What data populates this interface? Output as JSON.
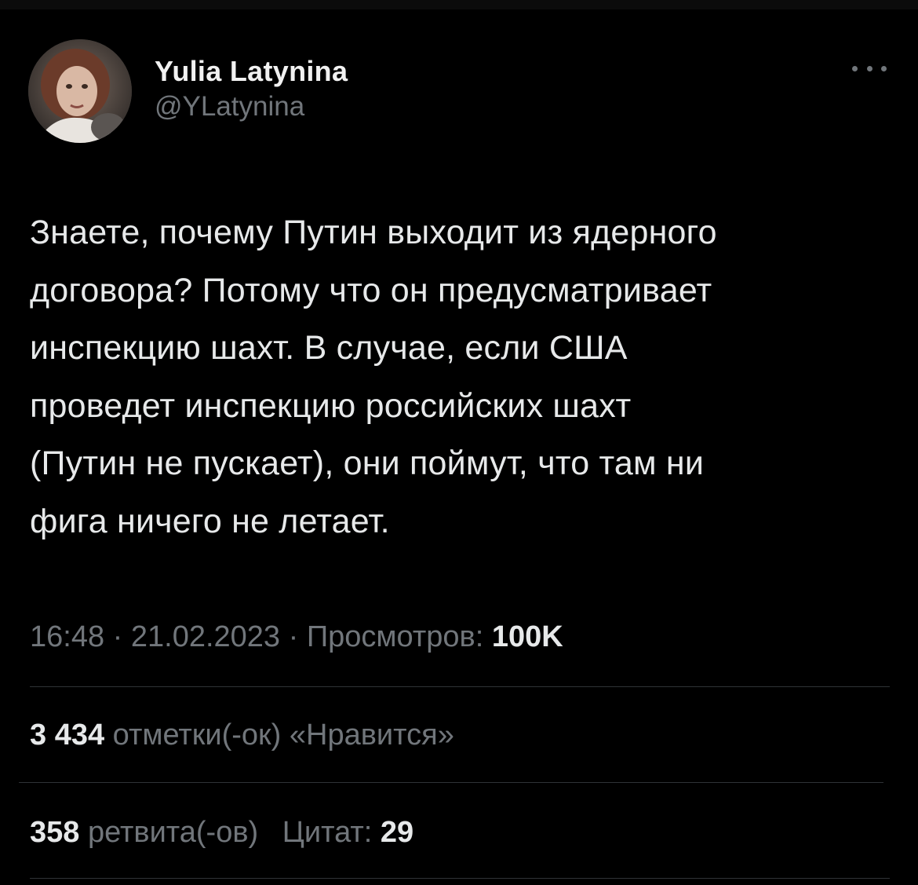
{
  "author": {
    "display_name": "Yulia Latynina",
    "handle": "@YLatynina",
    "avatar_icon": "profile-photo"
  },
  "more_icon": "more-horizontal-icon",
  "tweet": {
    "text": "Знаете, почему Путин выходит из ядерного\nдоговора? Потому что он предусматривает\nинспекцию шахт. В случае, если США\nпроведет инспекцию российских шахт\n(Путин не пускает), они поймут, что там ни\nфига ничего не летает."
  },
  "meta": {
    "time": "16:48",
    "separator": "·",
    "date": "21.02.2023",
    "views_label": "Просмотров:",
    "views_count": "100K"
  },
  "stats": {
    "likes_count": "3 434",
    "likes_label": "отметки(-ок) «Нравится»",
    "retweets_count": "358",
    "retweets_label": "ретвита(-ов)",
    "quotes_label": "Цитат:",
    "quotes_count": "29"
  },
  "colors": {
    "background": "#000000",
    "primary_text": "#e7e9ea",
    "secondary_text": "#71767b",
    "divider": "#2f3336"
  }
}
